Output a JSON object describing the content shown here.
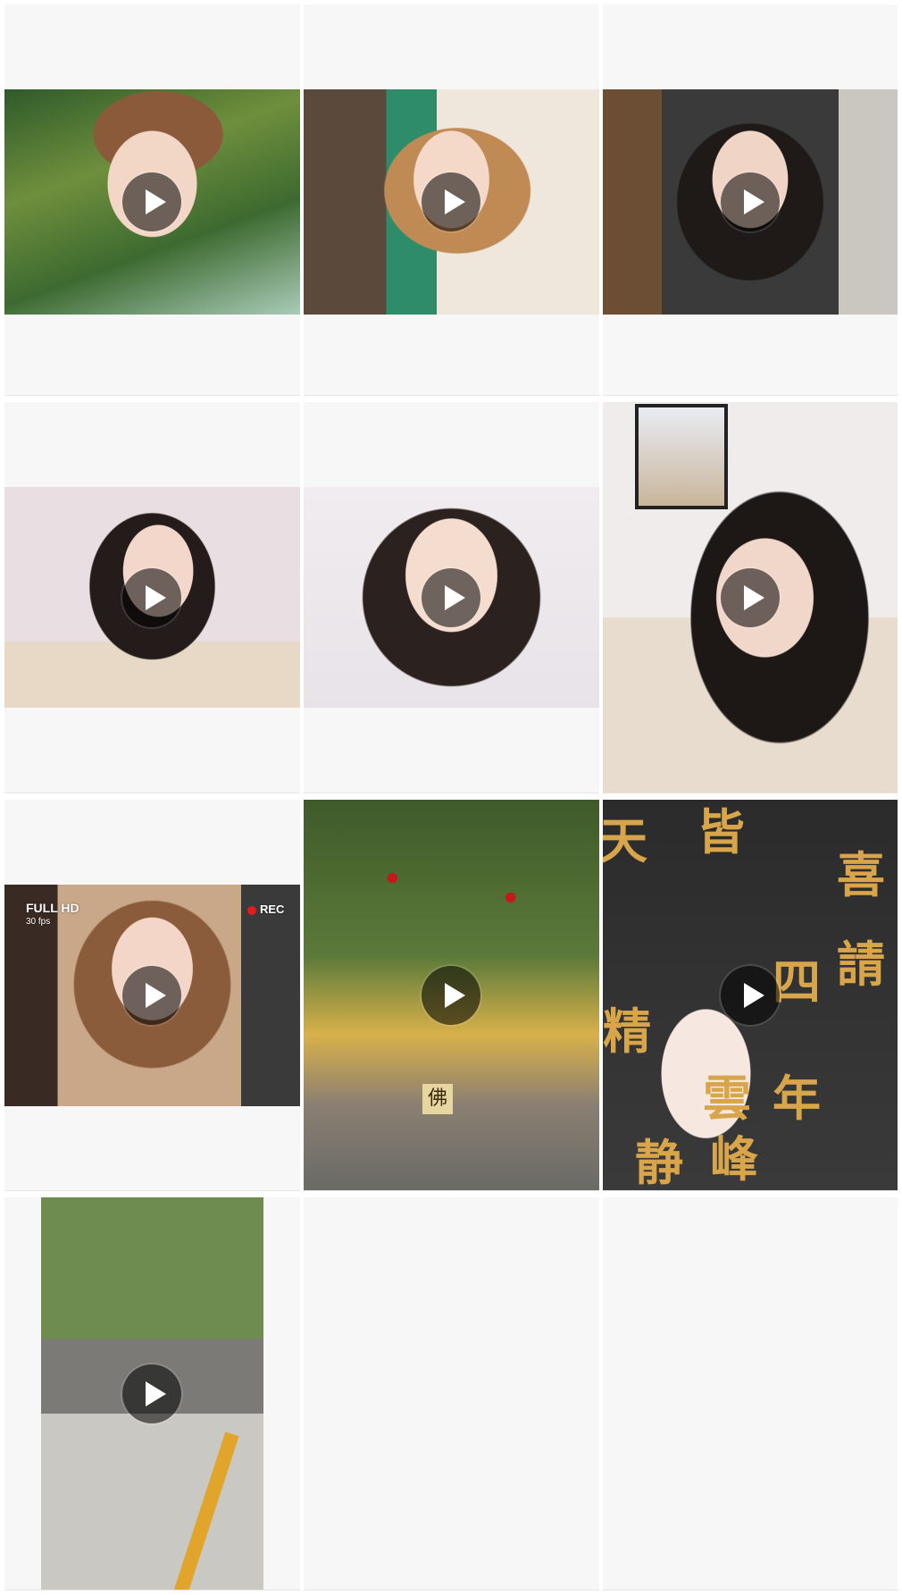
{
  "colors": {
    "cell_background": "#f7f7f7",
    "page_background": "#ffffff",
    "play_overlay": "rgba(0,0,0,0.55)"
  },
  "video_grid": {
    "items": [
      {
        "id": "video-1",
        "play_icon": "play-icon"
      },
      {
        "id": "video-2",
        "play_icon": "play-icon"
      },
      {
        "id": "video-3",
        "play_icon": "play-icon"
      },
      {
        "id": "video-4",
        "play_icon": "play-icon"
      },
      {
        "id": "video-5",
        "play_icon": "play-icon"
      },
      {
        "id": "video-6",
        "play_icon": "play-icon"
      },
      {
        "id": "video-7",
        "play_icon": "play-icon",
        "overlay": {
          "quality": "FULL HD",
          "fps": "30 fps",
          "rec": "REC"
        }
      },
      {
        "id": "video-8",
        "play_icon": "play-icon",
        "overlay": {
          "sign": "佛"
        }
      },
      {
        "id": "video-9",
        "play_icon": "play-icon",
        "overlay": {
          "chars": [
            "天",
            "皆",
            "四",
            "年",
            "雲",
            "峰",
            "静",
            "精",
            "喜",
            "請"
          ]
        }
      },
      {
        "id": "video-10",
        "play_icon": "play-icon"
      }
    ]
  }
}
